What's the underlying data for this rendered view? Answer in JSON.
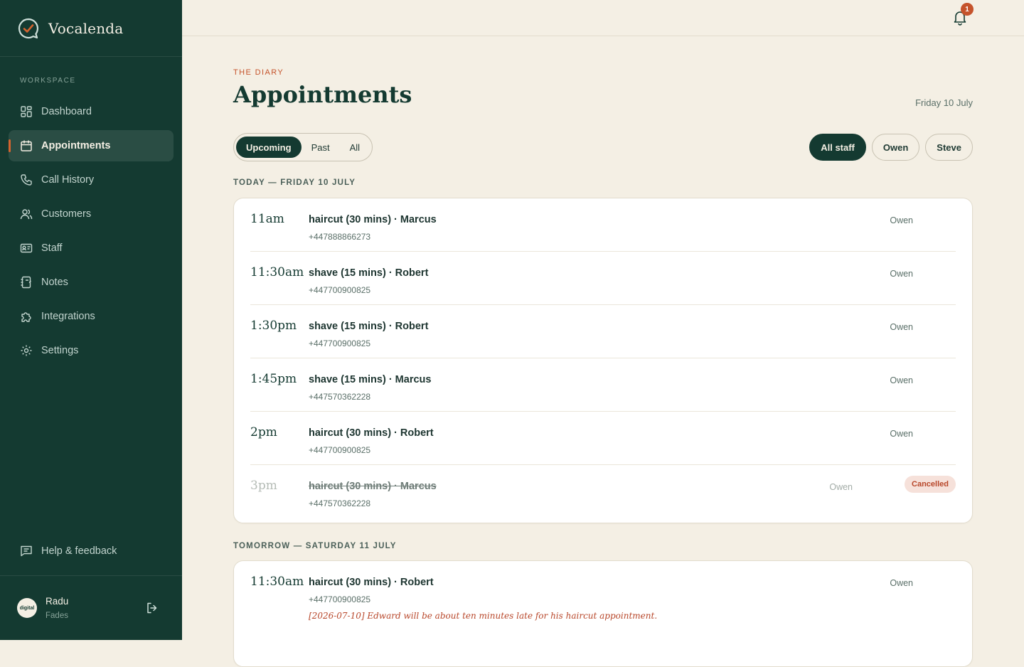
{
  "app": {
    "name": "Vocalenda"
  },
  "sidebar": {
    "section_label": "WORKSPACE",
    "items": [
      {
        "label": "Dashboard",
        "icon": "dashboard-icon"
      },
      {
        "label": "Appointments",
        "icon": "calendar-icon",
        "active": true
      },
      {
        "label": "Call History",
        "icon": "phone-icon"
      },
      {
        "label": "Customers",
        "icon": "users-icon"
      },
      {
        "label": "Staff",
        "icon": "id-card-icon"
      },
      {
        "label": "Notes",
        "icon": "notebook-icon"
      },
      {
        "label": "Integrations",
        "icon": "puzzle-icon"
      },
      {
        "label": "Settings",
        "icon": "gear-icon"
      }
    ],
    "help_label": "Help & feedback",
    "user": {
      "name": "Radu",
      "sub": "Fades",
      "avatar_text": "digital"
    }
  },
  "topbar": {
    "notification_count": "1"
  },
  "page": {
    "eyebrow": "THE DIARY",
    "title": "Appointments",
    "date": "Friday 10 July",
    "tabs": [
      "Upcoming",
      "Past",
      "All"
    ],
    "active_tab": "Upcoming",
    "staff_filters": [
      "All staff",
      "Owen",
      "Steve"
    ],
    "active_staff": "All staff"
  },
  "days": [
    {
      "heading": "TODAY — FRIDAY 10 JULY",
      "appointments": [
        {
          "time": "11am",
          "title": "haircut (30 mins) · Marcus",
          "phone": "+447888866273",
          "staff": "Owen"
        },
        {
          "time": "11:30am",
          "title": "shave (15 mins) · Robert",
          "phone": "+447700900825",
          "staff": "Owen"
        },
        {
          "time": "1:30pm",
          "title": "shave (15 mins) · Robert",
          "phone": "+447700900825",
          "staff": "Owen"
        },
        {
          "time": "1:45pm",
          "title": "shave (15 mins) · Marcus",
          "phone": "+447570362228",
          "staff": "Owen"
        },
        {
          "time": "2pm",
          "title": "haircut (30 mins) · Robert",
          "phone": "+447700900825",
          "staff": "Owen"
        },
        {
          "time": "3pm",
          "title": "haircut (30 mins) · Marcus",
          "phone": "+447570362228",
          "staff": "Owen",
          "status": "Cancelled"
        }
      ]
    },
    {
      "heading": "TOMORROW — SATURDAY 11 JULY",
      "appointments": [
        {
          "time": "11:30am",
          "title": "haircut (30 mins) · Robert",
          "phone": "+447700900825",
          "staff": "Owen",
          "note": "[2026-07-10] Edward will be about ten minutes late for his haircut appointment."
        }
      ]
    }
  ]
}
